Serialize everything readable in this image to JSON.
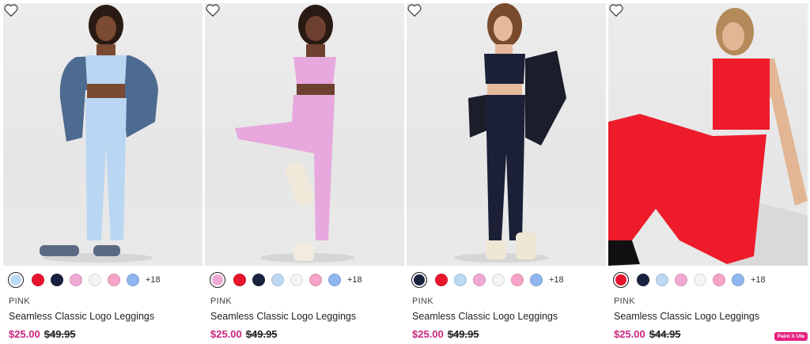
{
  "products": [
    {
      "brand": "PINK",
      "name": "Seamless Classic Logo Leggings",
      "sale_price": "$25.00",
      "original_price": "$49.95",
      "more_colors": "+18",
      "image_desc_color": "#b9d6f2",
      "swatches": [
        "#bcd8f3",
        "#e8142e",
        "#1a2240",
        "#f0a9d4",
        "#f5f5f5",
        "#f5a3c7",
        "#8fb6ef"
      ],
      "selected_swatch": 0
    },
    {
      "brand": "PINK",
      "name": "Seamless Classic Logo Leggings",
      "sale_price": "$25.00",
      "original_price": "$49.95",
      "more_colors": "+18",
      "image_desc_color": "#e7a8dd",
      "swatches": [
        "#f0a9d4",
        "#e8142e",
        "#1a2240",
        "#bcd8f3",
        "#f5f5f5",
        "#f5a3c7",
        "#8fb6ef"
      ],
      "selected_swatch": 0
    },
    {
      "brand": "PINK",
      "name": "Seamless Classic Logo Leggings",
      "sale_price": "$25.00",
      "original_price": "$49.95",
      "more_colors": "+18",
      "image_desc_color": "#1b2036",
      "swatches": [
        "#1a2240",
        "#e8142e",
        "#bcd8f3",
        "#f0a9d4",
        "#f5f5f5",
        "#f5a3c7",
        "#8fb6ef"
      ],
      "selected_swatch": 0
    },
    {
      "brand": "PINK",
      "name": "Seamless Classic Logo Leggings",
      "sale_price": "$25.00",
      "original_price": "$44.95",
      "more_colors": "+18",
      "image_desc_color": "#ee1b2b",
      "swatches": [
        "#e8142e",
        "#1a2240",
        "#bcd8f3",
        "#f0a9d4",
        "#f5f5f5",
        "#f5a3c7",
        "#8fb6ef"
      ],
      "selected_swatch": 0
    }
  ],
  "badge_text": "Paint X Ute",
  "icons": {
    "favorite": "heart-outline-icon"
  }
}
